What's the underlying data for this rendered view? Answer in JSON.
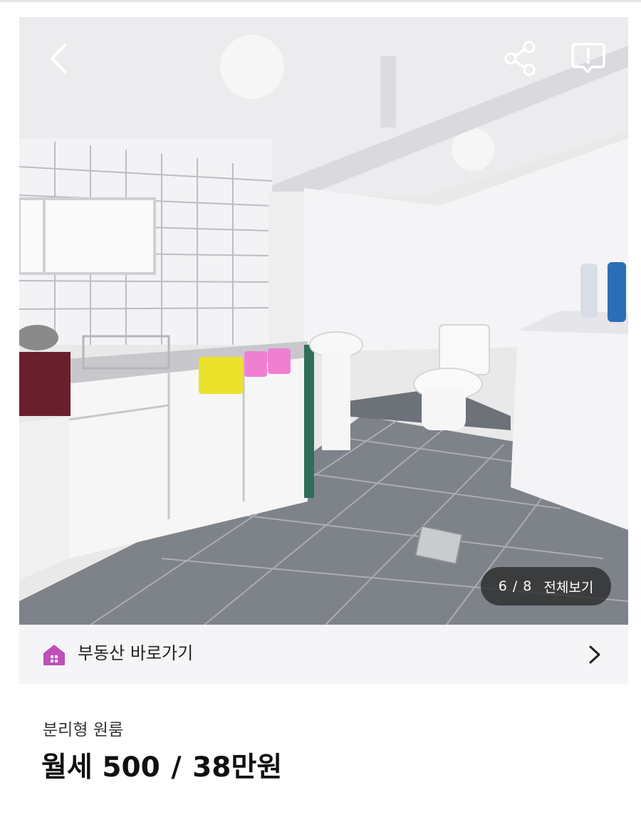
{
  "header": {
    "back_icon": "chevron-left-icon",
    "share_icon": "share-icon",
    "report_icon": "report-icon"
  },
  "gallery": {
    "current": "6",
    "total": "8",
    "counter_text": "6 / 8",
    "view_all_label": "전체보기"
  },
  "agency_link": {
    "icon": "house-icon",
    "label": "부동산 바로가기",
    "icon_color": "#c04fb8"
  },
  "listing": {
    "type": "분리형 원룸",
    "deal_type": "월세",
    "deposit": "500",
    "monthly_rent": "38만원",
    "price_text": "월세 500 / 38만원"
  }
}
